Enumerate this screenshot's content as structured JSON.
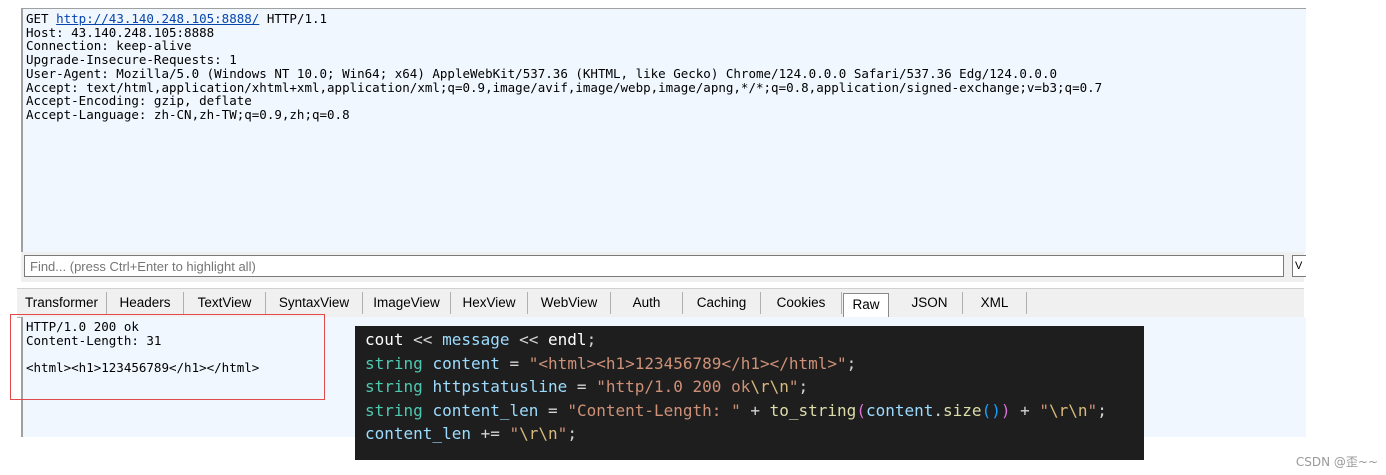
{
  "request": {
    "method": "GET",
    "url": "http://43.140.248.105:8888/",
    "protocol": "HTTP/1.1",
    "headers": [
      "Host: 43.140.248.105:8888",
      "Connection: keep-alive",
      "Upgrade-Insecure-Requests: 1",
      "User-Agent: Mozilla/5.0 (Windows NT 10.0; Win64; x64) AppleWebKit/537.36 (KHTML, like Gecko) Chrome/124.0.0.0 Safari/537.36 Edg/124.0.0.0",
      "Accept: text/html,application/xhtml+xml,application/xml;q=0.9,image/avif,image/webp,image/apng,*/*;q=0.8,application/signed-exchange;v=b3;q=0.7",
      "Accept-Encoding: gzip, deflate",
      "Accept-Language: zh-CN,zh-TW;q=0.9,zh;q=0.8"
    ]
  },
  "find": {
    "placeholder": "Find... (press Ctrl+Enter to highlight all)",
    "button_label": "V"
  },
  "tabs": [
    "Transformer",
    "Headers",
    "TextView",
    "SyntaxView",
    "ImageView",
    "HexView",
    "WebView",
    "Auth",
    "Caching",
    "Cookies",
    "Raw",
    "JSON",
    "XML"
  ],
  "active_tab": "Raw",
  "response": {
    "lines": [
      "HTTP/1.0 200 ok",
      "Content-Length: 31",
      "",
      "<html><h1>123456789</h1></html>"
    ]
  },
  "code": {
    "line1": {
      "a": "cout",
      "b": " << ",
      "c": "message",
      "d": " << ",
      "e": "endl",
      "f": ";"
    },
    "line2": {
      "type": "string",
      "name": "content",
      "op": " = ",
      "str": "\"<html><h1>123456789</h1></html>\"",
      "end": ";"
    },
    "line3": {
      "type": "string",
      "name": "httpstatusline",
      "op": " = ",
      "str": "\"http/1.0 200 ok",
      "esc": "\\r\\n",
      "q": "\"",
      "end": ";"
    },
    "line4": {
      "type": "string",
      "name": "content_len",
      "op": " = ",
      "str": "\"Content-Length: \"",
      "plus1": " + ",
      "fn": "to_string",
      "p1": "(",
      "obj": "content",
      "dot": ".",
      "m": "size",
      "p2": "()",
      "p3": ")",
      "plus2": " + ",
      "q1": "\"",
      "esc": "\\r\\n",
      "q2": "\"",
      "end": ";"
    },
    "line5": {
      "name": "content_len",
      "op": " += ",
      "q1": "\"",
      "esc": "\\r\\n",
      "q2": "\"",
      "end": ";"
    }
  },
  "watermark": "CSDN @歪~~"
}
